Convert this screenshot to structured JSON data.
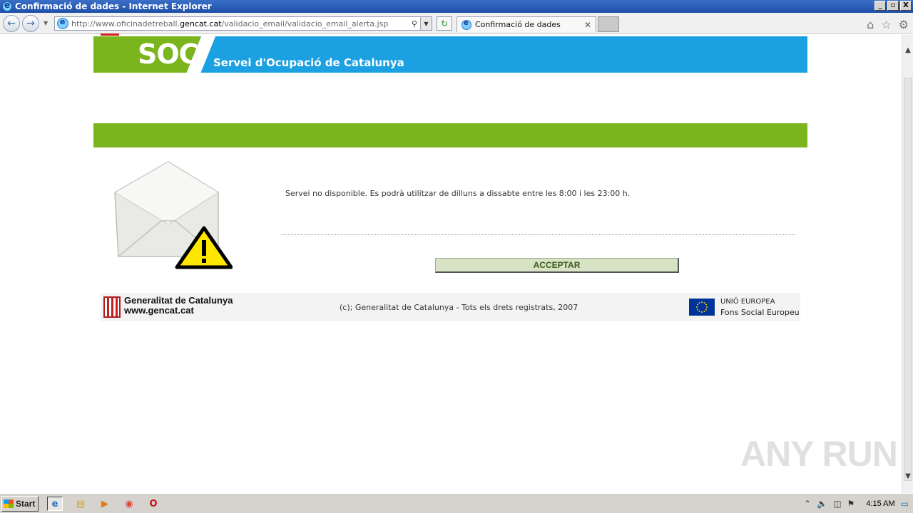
{
  "window": {
    "title": "Confirmació de dades - Internet Explorer",
    "min_label": "_",
    "max_label": "▫",
    "close_label": "X"
  },
  "browser": {
    "url_prefix": "http://www.oficinadetreball.",
    "url_domain": "gencat.cat",
    "url_path": "/validacio_email/validacio_email_alerta.jsp",
    "tab_title": "Confirmació de dades"
  },
  "header": {
    "logo": "SOC",
    "subtitle": "Servei d'Ocupació de Catalunya"
  },
  "content": {
    "message": "Servei no disponible. Es podrà utilitzar de dilluns a dissabte entre les 8:00 i les 23:00 h.",
    "accept_label": "ACCEPTAR"
  },
  "footer": {
    "gencat_line1": "Generalitat de Catalunya",
    "gencat_line2": "www.gencat.cat",
    "copyright": "(c); Generalitat de Catalunya - Tots els drets registrats, 2007",
    "eu_line1": "UNIÓ EUROPEA",
    "eu_line2": "Fons Social Europeu"
  },
  "watermark": "ANY RUN",
  "taskbar": {
    "start_label": "Start",
    "clock": "4:15 AM"
  },
  "colors": {
    "soc_green": "#7ab51d",
    "soc_blue": "#1ba0e2",
    "button_bg": "#d7e3c4",
    "button_text": "#3d5a1d"
  }
}
